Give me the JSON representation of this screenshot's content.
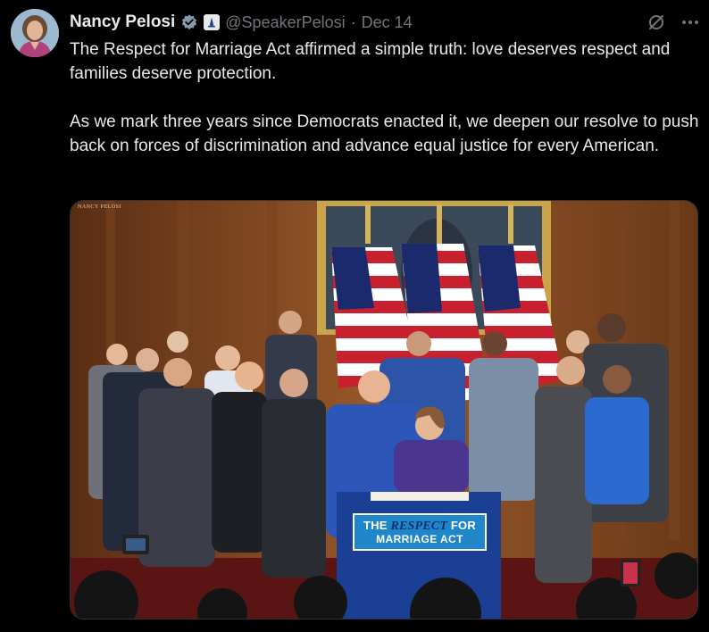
{
  "author": {
    "display_name": "Nancy Pelosi",
    "handle": "@SpeakerPelosi",
    "separator": "·",
    "date": "Dec 14"
  },
  "icons": {
    "avatar": "avatar-photo",
    "verified": "verified-badge-icon",
    "government": "government-badge-icon",
    "grok": "grok-icon",
    "more": "more-icon"
  },
  "tweet": {
    "paragraphs": [
      "The Respect for Marriage Act affirmed a simple truth: love deserves respect and families deserve protection.",
      "As we mark three years since Democrats enacted it, we deepen our resolve to push back on forces of discrimination and advance equal justice for every American."
    ]
  },
  "media": {
    "photo_credit": "NANCY PELOSI",
    "sign_line1_part1": "THE ",
    "sign_line1_emphasis": "RESPECT",
    "sign_line1_part2": " FOR",
    "sign_line2": "MARRIAGE ACT"
  },
  "colors": {
    "background": "#000000",
    "text_primary": "#e7e9ea",
    "text_secondary": "#71767b",
    "verified": "#1d9bf0",
    "sign_blue": "#1f86c9",
    "table_blue": "#1b3f94"
  }
}
